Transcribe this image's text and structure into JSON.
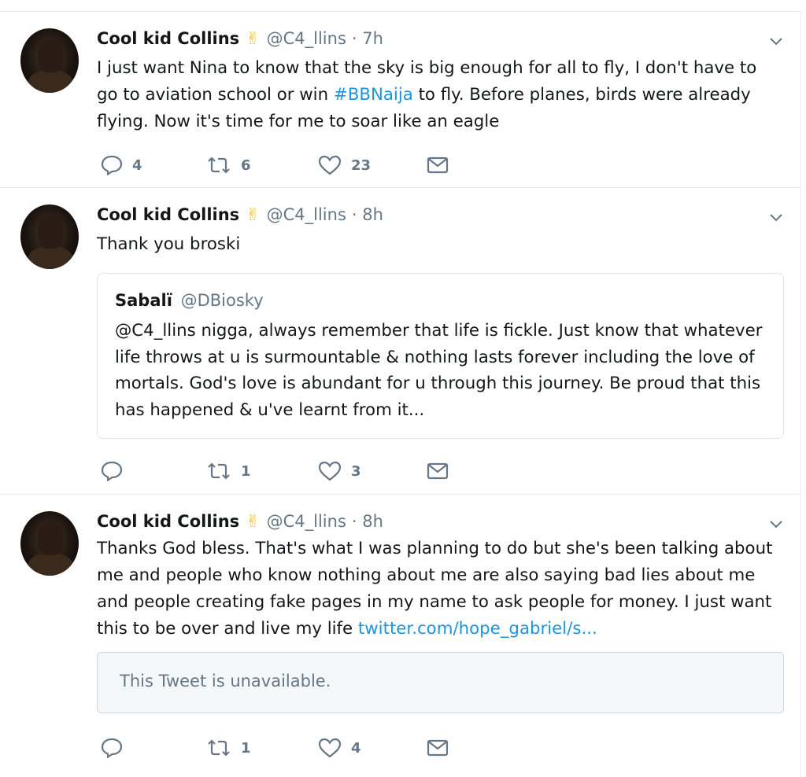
{
  "tweets": [
    {
      "author_name": "Cool kid Collins",
      "emoji": "✌",
      "handle": "@C4_llins",
      "time": "· 7h",
      "text_before": "I just want Nina to know that the sky is big enough for all to fly, I don't have to go to aviation school or win ",
      "hashtag": "#BBNaija",
      "text_after": " to fly. Before planes, birds were already flying. Now it's time for me to soar like an eagle",
      "replies": "4",
      "retweets": "6",
      "likes": "23"
    },
    {
      "author_name": "Cool kid Collins",
      "emoji": "✌",
      "handle": "@C4_llins",
      "time": "· 8h",
      "text": "Thank you broski",
      "quote": {
        "name": "Sabalï",
        "handle": "@DBiosky",
        "text": "@C4_llins nigga, always remember that life is fickle. Just know that whatever life throws at u is surmountable & nothing lasts forever including the love of mortals. God's love is abundant for u through this journey. Be proud that this has happened & u've learnt from it..."
      },
      "replies": "",
      "retweets": "1",
      "likes": "3"
    },
    {
      "author_name": "Cool kid Collins",
      "emoji": "✌",
      "handle": "@C4_llins",
      "time": "· 8h",
      "text": "Thanks God bless. That's what I was planning to do but she's been talking about me and people who know nothing about me are also saying bad lies about me and people creating fake pages in my name to ask people for money. I just want this to be over and live my life ",
      "link": "twitter.com/hope_gabriel/s...",
      "unavailable": "This Tweet is unavailable.",
      "replies": "",
      "retweets": "1",
      "likes": "4"
    }
  ],
  "icons": [
    "reply-icon",
    "retweet-icon",
    "like-icon",
    "message-icon",
    "chevron-down-icon"
  ],
  "colors": {
    "link": "#1b95e0",
    "muted": "#657786",
    "border": "#e6ecf0"
  }
}
